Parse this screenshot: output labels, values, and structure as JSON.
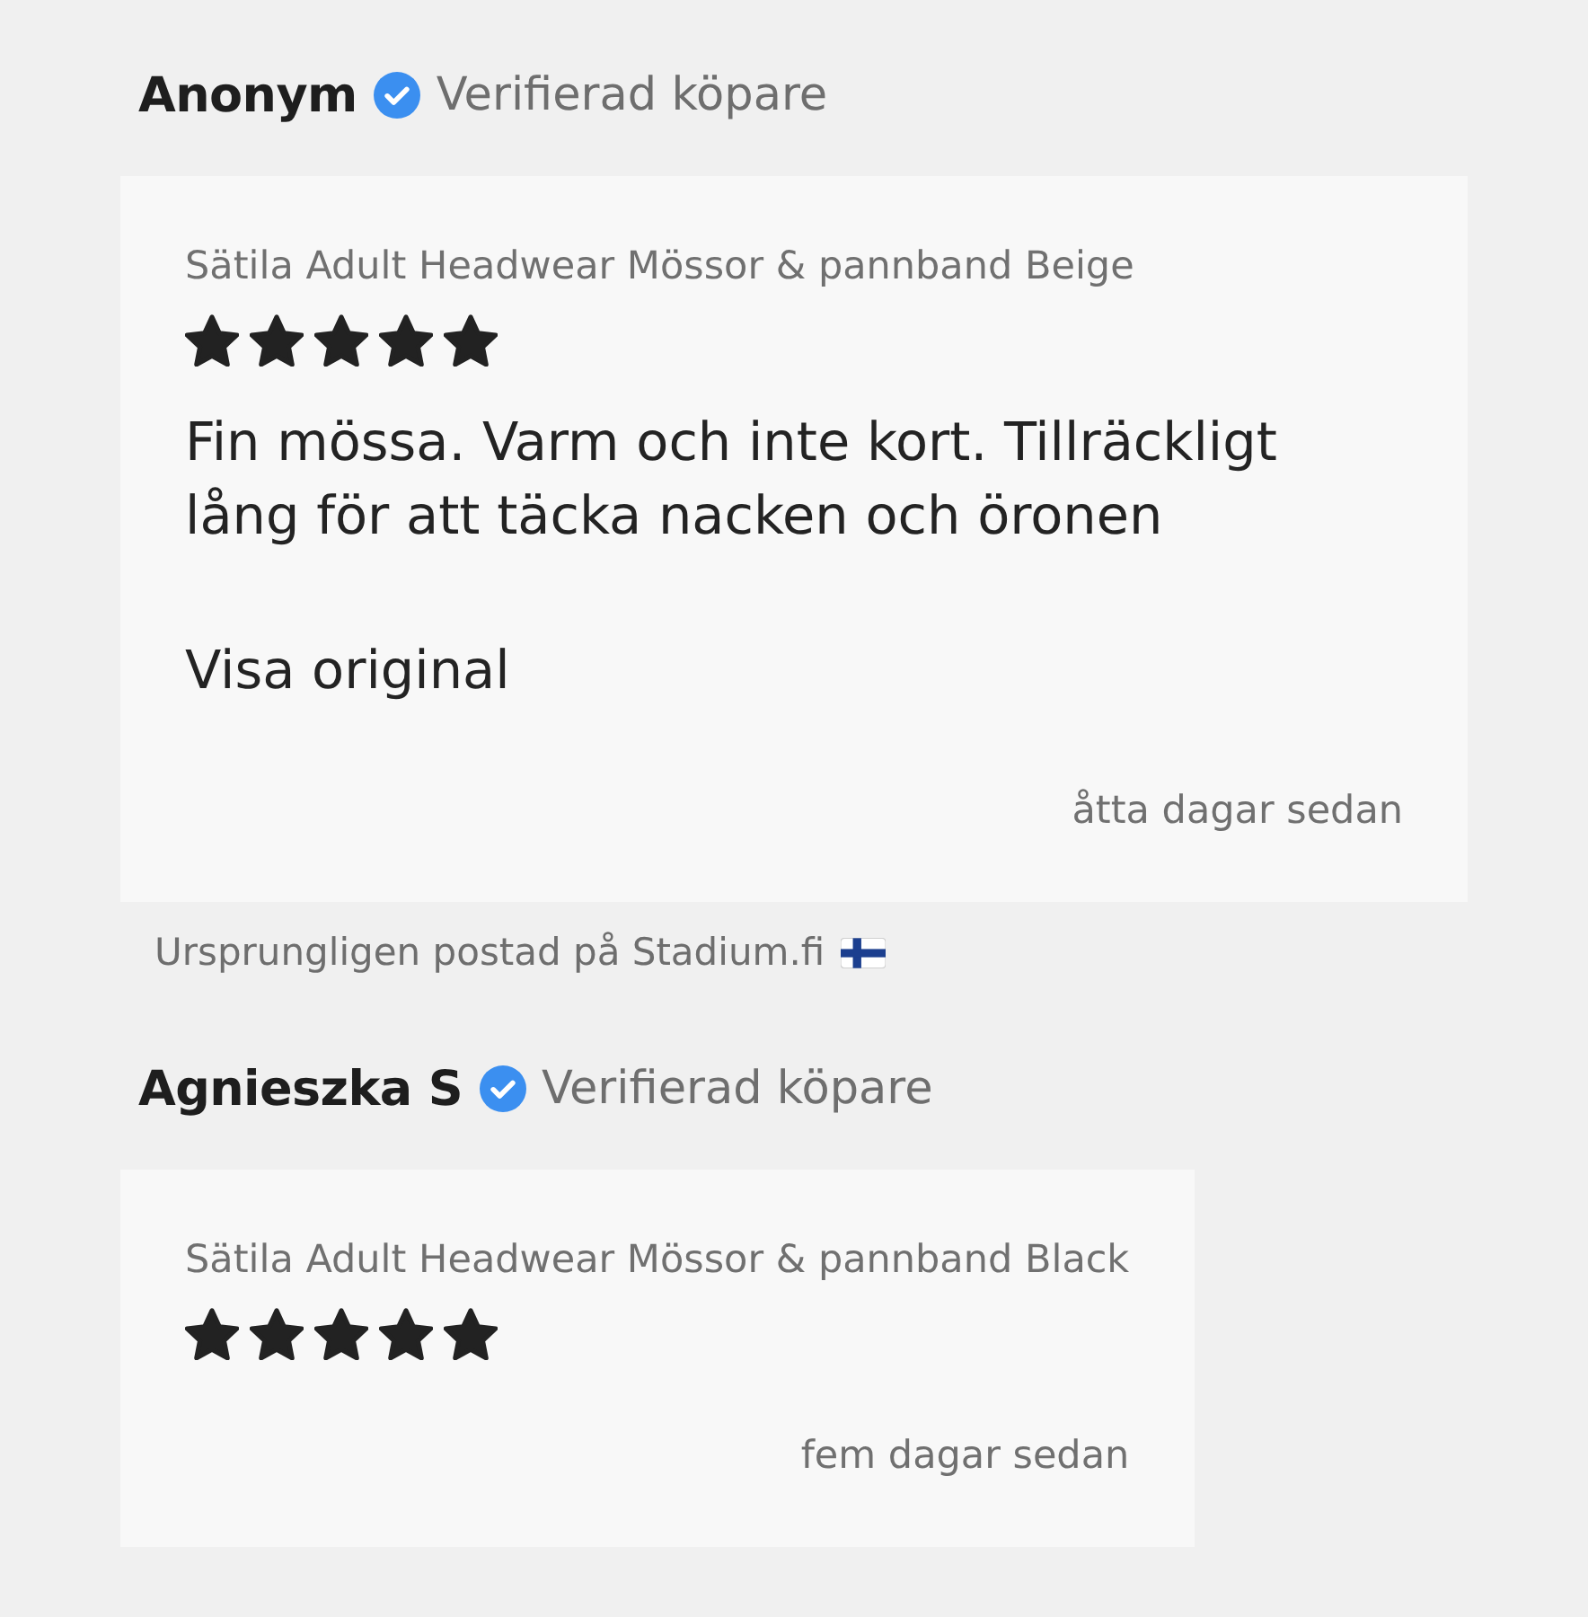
{
  "reviews": [
    {
      "author": "Anonym",
      "verified": true,
      "badge_label": "Verifierad köpare",
      "product": "Sätila Adult Headwear Mössor & pannband Beige",
      "stars": 5,
      "text": "Fin mössa. Varm och inte kort. Tillräckligt lång för att täcka nacken och öronen",
      "translation_link": "Visa original",
      "date": "åtta dagar sedan",
      "origin_note": "Ursprungligen postad på Stadium.fi"
    },
    {
      "author": "Agnieszka S",
      "verified": true,
      "badge_label": "Verifierad köpare",
      "product": "Sätila Adult Headwear Mössor & pannband Black",
      "stars": 5,
      "date": "fem dagar sedan"
    }
  ]
}
